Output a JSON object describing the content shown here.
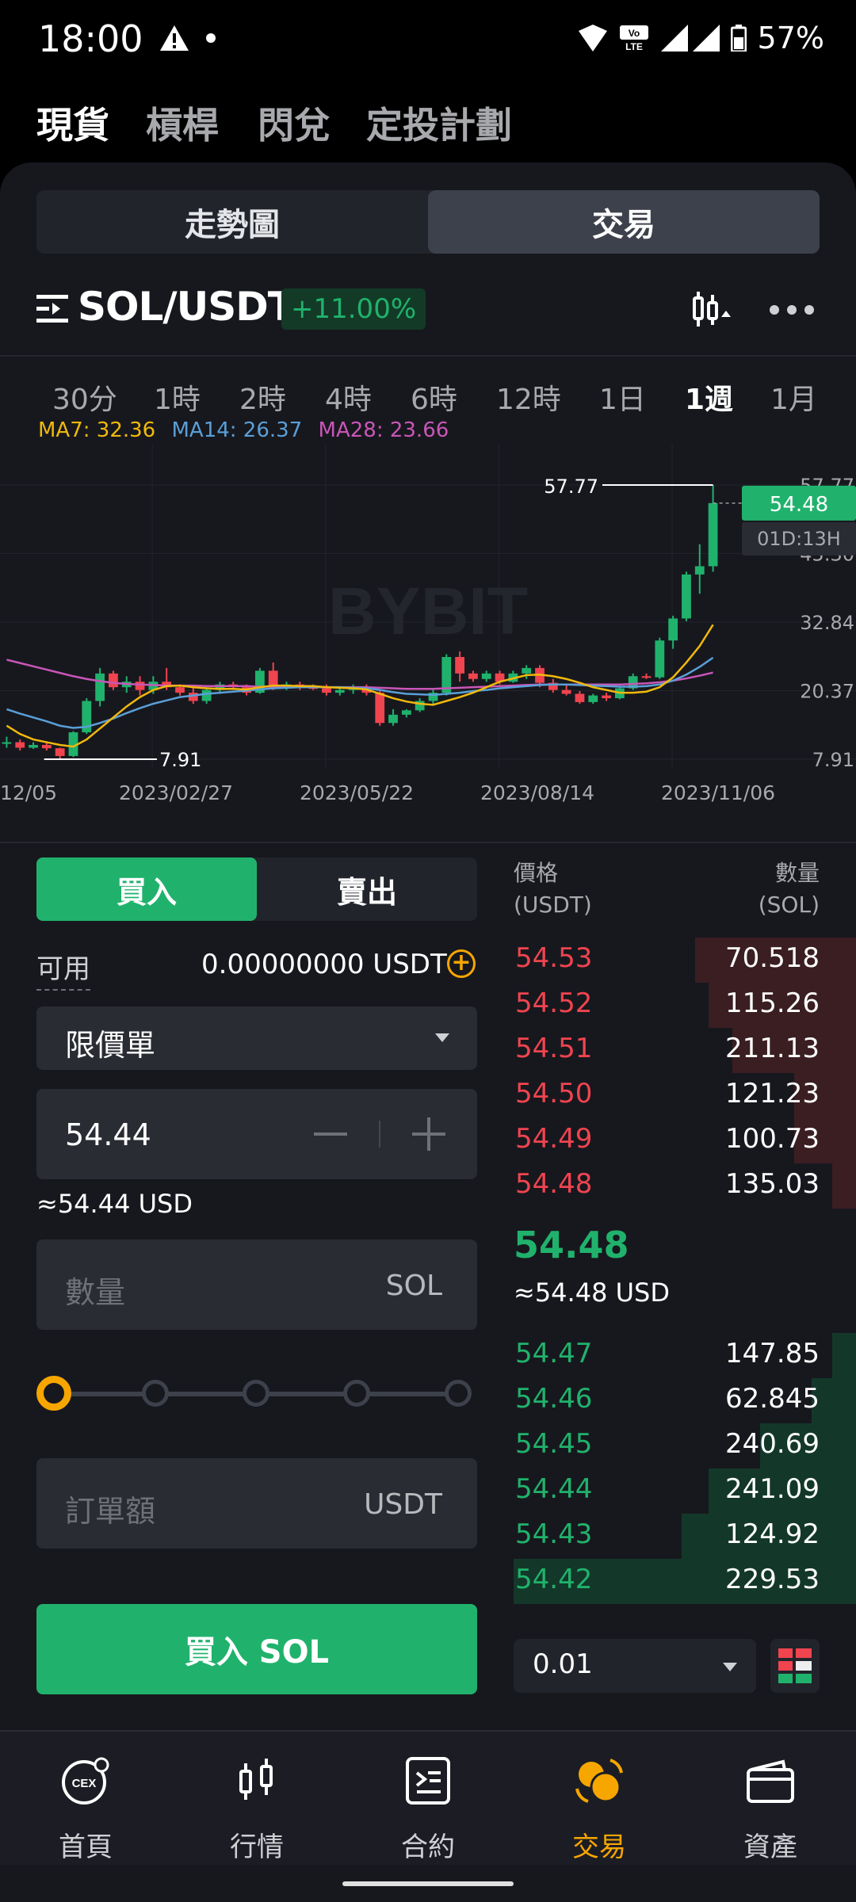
{
  "status_bar": {
    "time": "18:00",
    "battery": "57%"
  },
  "top_tabs": [
    {
      "label": "現貨",
      "active": true
    },
    {
      "label": "槓桿",
      "active": false
    },
    {
      "label": "閃兌",
      "active": false
    },
    {
      "label": "定投計劃",
      "active": false
    }
  ],
  "segment": {
    "chart_label": "走勢圖",
    "trade_label": "交易"
  },
  "pair": {
    "name": "SOL/USDT",
    "change": "+11.00%"
  },
  "timeframes": [
    "30分",
    "1時",
    "2時",
    "4時",
    "6時",
    "12時",
    "1日",
    "1週",
    "1月"
  ],
  "active_timeframe": "1週",
  "ma": {
    "ma7": "MA7: 32.36",
    "ma14": "MA14: 26.37",
    "ma28": "MA28: 23.66"
  },
  "chart_data": {
    "type": "candlestick",
    "watermark": "BYBIT",
    "y_ticks": [
      "57.77",
      "45.30",
      "32.84",
      "20.37",
      "7.91"
    ],
    "ylim": [
      7.91,
      57.77
    ],
    "x_ticks": [
      "12/05",
      "2023/02/27",
      "2023/05/22",
      "2023/08/14",
      "2023/11/06"
    ],
    "high_label": "57.77",
    "low_label": "7.91",
    "current_price": "54.48",
    "countdown": "01D:13H",
    "candles": [
      [
        11,
        12,
        10,
        11
      ],
      [
        11,
        11.5,
        9.5,
        10
      ],
      [
        10,
        11,
        9.8,
        10.5
      ],
      [
        10.5,
        11,
        9.5,
        9.9
      ],
      [
        9.9,
        10,
        7.91,
        8.5
      ],
      [
        8.5,
        13,
        8.3,
        12.8
      ],
      [
        12.8,
        19,
        12.5,
        18.5
      ],
      [
        18.5,
        24.5,
        17.5,
        23.5
      ],
      [
        23.5,
        24,
        20.5,
        21
      ],
      [
        21,
        23,
        20,
        22
      ],
      [
        22,
        23,
        19.5,
        20.5
      ],
      [
        20.5,
        23,
        19.8,
        22
      ],
      [
        22,
        24.5,
        20.5,
        21
      ],
      [
        21,
        21.5,
        19.5,
        20
      ],
      [
        20,
        21,
        18,
        18.5
      ],
      [
        18.5,
        21,
        18,
        20.5
      ],
      [
        20.5,
        22,
        19.8,
        21.5
      ],
      [
        21.5,
        22,
        20.5,
        21
      ],
      [
        21,
        21.5,
        19.5,
        20
      ],
      [
        20,
        24.5,
        19.8,
        24
      ],
      [
        24,
        25.5,
        20.5,
        21
      ],
      [
        21,
        22,
        20.5,
        21.5
      ],
      [
        21.5,
        22,
        20.5,
        21
      ],
      [
        21,
        21.5,
        20.5,
        20.8
      ],
      [
        20.8,
        21.5,
        19.5,
        20
      ],
      [
        20,
        21,
        19.5,
        20.5
      ],
      [
        20.5,
        21.5,
        19.8,
        21
      ],
      [
        21,
        21.5,
        19.5,
        20
      ],
      [
        20,
        20.5,
        14,
        14.5
      ],
      [
        14.5,
        17,
        14,
        16
      ],
      [
        16,
        17,
        15.5,
        16.8
      ],
      [
        16.8,
        19,
        16.5,
        18.5
      ],
      [
        18.5,
        20.5,
        18,
        20
      ],
      [
        20,
        27,
        19.5,
        26.5
      ],
      [
        26.5,
        27.5,
        22,
        23.5
      ],
      [
        23.5,
        24,
        22,
        22.5
      ],
      [
        22.5,
        24,
        22,
        23.5
      ],
      [
        23.5,
        24,
        21.5,
        22
      ],
      [
        22,
        24,
        21.8,
        23.5
      ],
      [
        23.5,
        25,
        22.5,
        24.5
      ],
      [
        24.5,
        25,
        21,
        21.8
      ],
      [
        21.8,
        22.5,
        20,
        20.5
      ],
      [
        20.5,
        21.5,
        19.5,
        19.8
      ],
      [
        19.8,
        20.3,
        18,
        18.3
      ],
      [
        18.3,
        19.8,
        18,
        19.5
      ],
      [
        19.5,
        20,
        18.5,
        19
      ],
      [
        19,
        21,
        18.8,
        20.8
      ],
      [
        20.8,
        23.5,
        20.5,
        23
      ],
      [
        23,
        23.5,
        22.5,
        22.8
      ],
      [
        22.8,
        30,
        22.5,
        29.5
      ],
      [
        29.5,
        34,
        28,
        33.5
      ],
      [
        33.5,
        42,
        33,
        41.5
      ],
      [
        41.5,
        47,
        38,
        43
      ],
      [
        43,
        57.77,
        42,
        54.48
      ]
    ],
    "ma7_series": [
      14,
      12.5,
      11.5,
      11,
      10.5,
      10.2,
      11.5,
      13.5,
      15.5,
      17.5,
      19.2,
      20.5,
      21.2,
      21.3,
      21,
      20.8,
      20.7,
      20.7,
      20.6,
      21,
      21.3,
      21.3,
      21.2,
      21.2,
      21,
      20.9,
      20.8,
      20.6,
      19.8,
      19,
      18.4,
      18,
      17.8,
      18.5,
      19.2,
      20,
      21,
      22,
      22.6,
      23.2,
      23.3,
      23,
      22.5,
      21.8,
      21,
      20.5,
      20,
      20,
      20.2,
      21,
      22.8,
      25.5,
      28.5,
      32.36
    ],
    "ma14_series": [
      17,
      16.2,
      15.5,
      14.8,
      14,
      13.6,
      13.8,
      14.5,
      15.3,
      16.3,
      17.2,
      18,
      18.6,
      19.2,
      19.5,
      19.8,
      20,
      20.2,
      20.4,
      20.6,
      20.8,
      20.9,
      21,
      21,
      21,
      21,
      20.9,
      20.8,
      20.5,
      20.1,
      19.8,
      19.7,
      19.6,
      19.8,
      20,
      20.3,
      20.5,
      20.8,
      21,
      21.2,
      21.4,
      21.5,
      21.5,
      21.4,
      21.3,
      21.2,
      21.1,
      21.1,
      21.2,
      21.5,
      22.2,
      23.3,
      24.7,
      26.37
    ],
    "ma28_series": [
      26,
      25.4,
      24.8,
      24.2,
      23.6,
      23,
      22.5,
      22.1,
      21.8,
      21.6,
      21.5,
      21.4,
      21.3,
      21.3,
      21.3,
      21.2,
      21.2,
      21.2,
      21.2,
      21.1,
      21.1,
      21.1,
      21.1,
      21.1,
      21,
      21,
      21,
      21,
      20.9,
      20.8,
      20.7,
      20.7,
      20.7,
      20.8,
      20.9,
      21,
      21.1,
      21.2,
      21.3,
      21.4,
      21.5,
      21.5,
      21.5,
      21.5,
      21.5,
      21.5,
      21.5,
      21.6,
      21.7,
      21.9,
      22.2,
      22.6,
      23.1,
      23.66
    ]
  },
  "order_form": {
    "buy_label": "買入",
    "sell_label": "賣出",
    "available_label": "可用",
    "available_value": "0.00000000 USDT",
    "order_type": "限價單",
    "price_value": "54.44",
    "price_approx": "≈54.44 USD",
    "qty_placeholder": "數量",
    "qty_unit": "SOL",
    "amount_placeholder": "訂單額",
    "amount_unit": "USDT",
    "submit_label": "買入 SOL",
    "slider_level": 0
  },
  "orderbook": {
    "price_header": "價格",
    "price_header_unit": "(USDT)",
    "qty_header": "數量",
    "qty_header_unit": "(SOL)",
    "asks": [
      {
        "price": "54.53",
        "qty": "70.518",
        "depth": 0.47
      },
      {
        "price": "54.52",
        "qty": "115.26",
        "depth": 0.43
      },
      {
        "price": "54.51",
        "qty": "211.13",
        "depth": 0.36
      },
      {
        "price": "54.50",
        "qty": "121.23",
        "depth": 0.18
      },
      {
        "price": "54.49",
        "qty": "100.73",
        "depth": 0.18
      },
      {
        "price": "54.48",
        "qty": "135.03",
        "depth": 0.07
      }
    ],
    "last_price": "54.48",
    "last_price_usd": "≈54.48 USD",
    "bids": [
      {
        "price": "54.47",
        "qty": "147.85",
        "depth": 0.07
      },
      {
        "price": "54.46",
        "qty": "62.845",
        "depth": 0.13
      },
      {
        "price": "54.45",
        "qty": "240.69",
        "depth": 0.28
      },
      {
        "price": "54.44",
        "qty": "241.09",
        "depth": 0.43
      },
      {
        "price": "54.43",
        "qty": "124.92",
        "depth": 0.51
      },
      {
        "price": "54.42",
        "qty": "229.53",
        "depth": 1.0
      }
    ],
    "depth_step": "0.01"
  },
  "bottom_nav": [
    {
      "label": "首頁",
      "icon": "cex-home-icon",
      "active": false
    },
    {
      "label": "行情",
      "icon": "candlestick-icon",
      "active": false
    },
    {
      "label": "合約",
      "icon": "contract-icon",
      "active": false
    },
    {
      "label": "交易",
      "icon": "trade-coins-icon",
      "active": true
    },
    {
      "label": "資產",
      "icon": "wallet-icon",
      "active": false
    }
  ],
  "colors": {
    "up": "#20b26c",
    "down": "#f0444f",
    "accent": "#f7a600",
    "ma7": "#f0b90b",
    "ma14": "#5a9fd8",
    "ma28": "#c956b8"
  }
}
